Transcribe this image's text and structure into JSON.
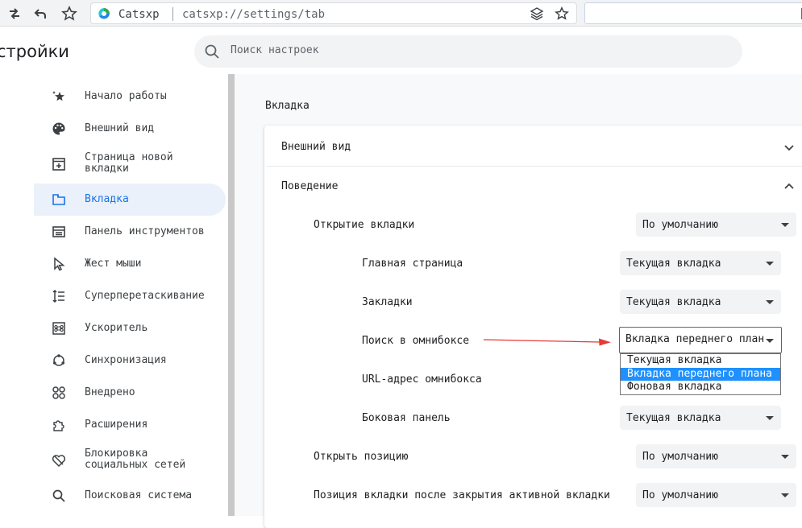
{
  "toolbar": {
    "omnibox_site": "Catsxp",
    "omnibox_url": "catsxp://settings/tab"
  },
  "header": {
    "title": "стройки",
    "search_placeholder": "Поиск настроек"
  },
  "sidebar": {
    "items": [
      {
        "label": "Начало работы",
        "icon": "sparkle-star-icon"
      },
      {
        "label": "Внешний вид",
        "icon": "palette-icon"
      },
      {
        "label": "Страница новой\nвкладки",
        "icon": "new-tab-page-icon"
      },
      {
        "label": "Вкладка",
        "icon": "tab-icon",
        "active": true
      },
      {
        "label": "Панель инструментов",
        "icon": "toolbar-icon"
      },
      {
        "label": "Жест мыши",
        "icon": "mouse-pointer-icon"
      },
      {
        "label": "Суперперетаскивание",
        "icon": "drag-lines-icon"
      },
      {
        "label": "Ускоритель",
        "icon": "command-key-icon"
      },
      {
        "label": "Синхронизация",
        "icon": "sync-icon"
      },
      {
        "label": "Внедрено",
        "icon": "embedded-icon"
      },
      {
        "label": "Расширения",
        "icon": "puzzle-icon"
      },
      {
        "label": "Блокировка\nсоциальных сетей",
        "icon": "social-block-icon"
      },
      {
        "label": "Поисковая система",
        "icon": "search-icon"
      }
    ]
  },
  "main": {
    "section_title": "Вкладка",
    "appearance_label": "Внешний вид",
    "behavior_label": "Поведение",
    "open_tab_label": "Открытие вкладки",
    "open_tab_value": "По умолчанию",
    "home_page_label": "Главная страница",
    "home_page_value": "Текущая вкладка",
    "bookmarks_label": "Закладки",
    "bookmarks_value": "Текущая вкладка",
    "omnibox_search_label": "Поиск в омнибоксе",
    "omnibox_search_value": "Вкладка переднего план",
    "omnibox_url_label": "URL-адрес омнибокса",
    "side_panel_label": "Боковая панель",
    "side_panel_value": "Текущая вкладка",
    "open_position_label": "Открыть позицию",
    "open_position_value": "По умолчанию",
    "after_close_label": "Позиция вкладки после закрытия активной вкладки",
    "after_close_value": "По умолчанию",
    "dropdown_options": [
      "Текущая вкладка",
      "Вкладка переднего плана",
      "Фоновая вкладка"
    ],
    "dropdown_selected_index": 1
  },
  "colors": {
    "accent": "#1a73e8",
    "annotation_arrow": "#e53935",
    "dropdown_highlight": "#1e90ff"
  }
}
